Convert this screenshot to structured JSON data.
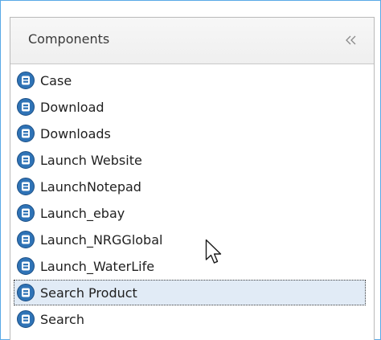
{
  "panel": {
    "title": "Components",
    "collapse_icon": "double-chevron-left-icon",
    "collapse_glyph": "«"
  },
  "components": {
    "item_icon": "component-badge-icon",
    "items": [
      {
        "label": "Case",
        "selected": false
      },
      {
        "label": "Download",
        "selected": false
      },
      {
        "label": "Downloads",
        "selected": false
      },
      {
        "label": "Launch Website",
        "selected": false
      },
      {
        "label": "LaunchNotepad",
        "selected": false
      },
      {
        "label": "Launch_ebay",
        "selected": false
      },
      {
        "label": "Launch_NRGGlobal",
        "selected": false
      },
      {
        "label": "Launch_WaterLife",
        "selected": false
      },
      {
        "label": "Search Product",
        "selected": true
      },
      {
        "label": "Search",
        "selected": false
      }
    ]
  },
  "colors": {
    "window_border": "#5aa9e6",
    "selection_background": "#e1ebf6",
    "icon_blue": "#2f73b6"
  },
  "mouse_cursor_icon": "arrow-pointer-icon"
}
